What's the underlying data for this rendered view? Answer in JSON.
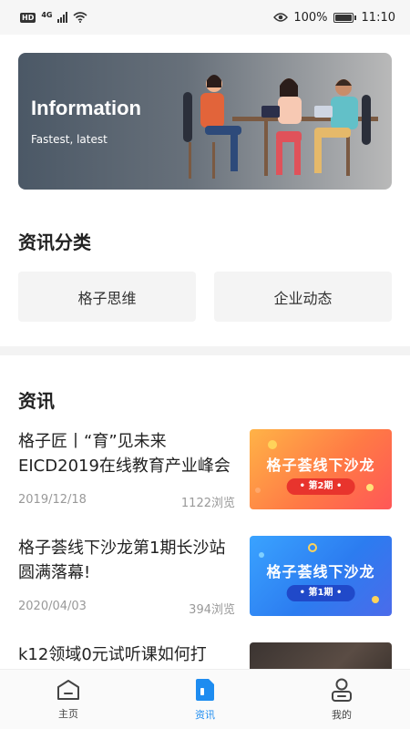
{
  "status_bar": {
    "network_badge": "HD",
    "network_type": "4G",
    "battery_text": "100%",
    "time": "11:10"
  },
  "banner": {
    "title": "Information",
    "subtitle": "Fastest, latest"
  },
  "categories": {
    "title": "资讯分类",
    "items": [
      {
        "label": "格子思维"
      },
      {
        "label": "企业动态"
      }
    ]
  },
  "news": {
    "title": "资讯",
    "items": [
      {
        "title": "格子匠丨“育”见未来EICD2019在线教育产业峰会",
        "date": "2019/12/18",
        "views": "1122浏览",
        "thumb_title": "格子荟线下沙龙",
        "thumb_badge": "• 第2期 •"
      },
      {
        "title": "格子荟线下沙龙第1期长沙站圆满落幕!",
        "date": "2020/04/03",
        "views": "394浏览",
        "thumb_title": "格子荟线下沙龙",
        "thumb_badge": "• 第1期 •"
      },
      {
        "title": "k12领域0元试听课如何打",
        "date": "",
        "views": ""
      }
    ]
  },
  "bottom_nav": {
    "items": [
      {
        "label": "主页",
        "icon": "home-icon"
      },
      {
        "label": "资讯",
        "icon": "news-icon",
        "active": true
      },
      {
        "label": "我的",
        "icon": "user-icon"
      }
    ]
  },
  "colors": {
    "accent": "#1e8cf0",
    "banner_dark": "#4b5866",
    "thumb_orange": "#ff7a45",
    "thumb_blue": "#2c7cf0"
  }
}
